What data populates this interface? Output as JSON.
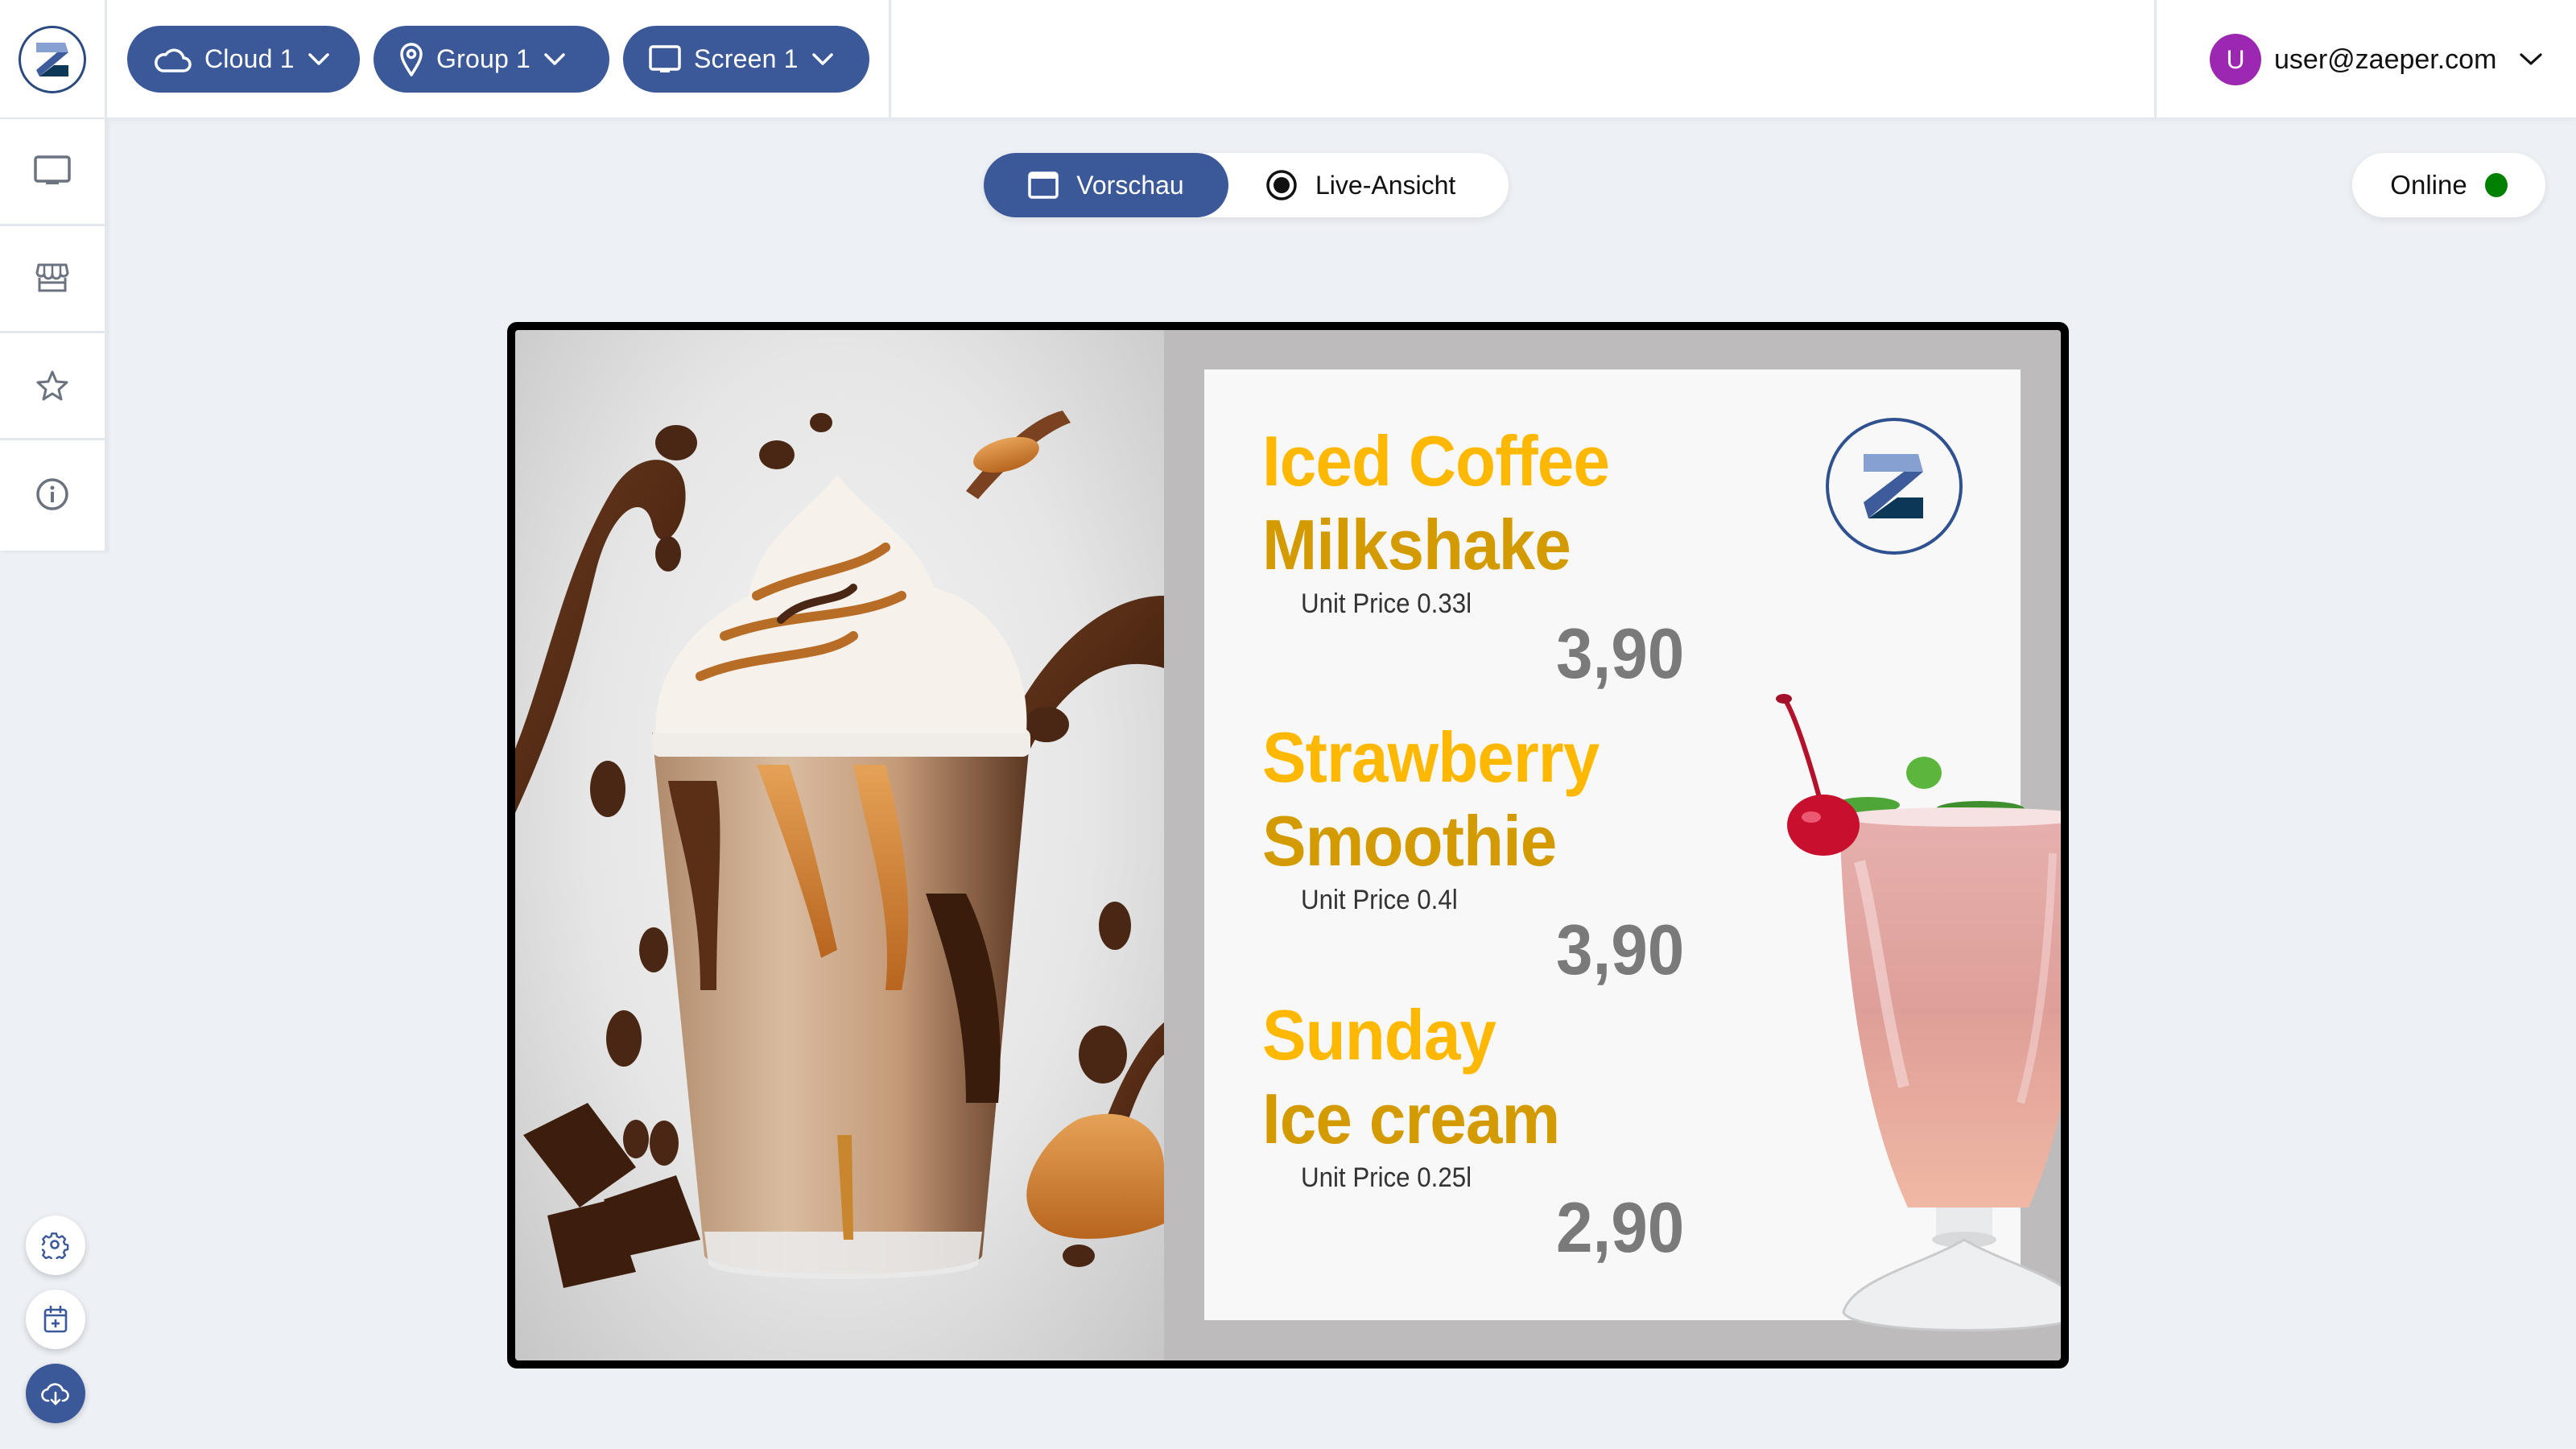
{
  "header": {
    "logo": "zaeper-logo",
    "selectors": [
      {
        "label": "Cloud 1",
        "icon": "cloud-icon"
      },
      {
        "label": "Group 1",
        "icon": "map-pin-icon"
      },
      {
        "label": "Screen 1",
        "icon": "monitor-icon"
      }
    ],
    "user": {
      "initial": "U",
      "email": "user@zaeper.com",
      "avatar_color": "#9c27b0"
    }
  },
  "sidebar": {
    "items": [
      {
        "name": "screens",
        "icon": "monitor-icon"
      },
      {
        "name": "store",
        "icon": "store-icon"
      },
      {
        "name": "favorites",
        "icon": "star-icon"
      },
      {
        "name": "info",
        "icon": "info-icon"
      }
    ],
    "actions": [
      {
        "name": "settings",
        "icon": "gear-icon"
      },
      {
        "name": "schedule",
        "icon": "calendar-plus-icon"
      },
      {
        "name": "cloud-download",
        "icon": "cloud-download-icon"
      }
    ]
  },
  "view_toggle": {
    "options": [
      {
        "label": "Vorschau",
        "icon": "window-icon",
        "active": true
      },
      {
        "label": "Live-Ansicht",
        "icon": "radio-dot-icon",
        "active": false
      }
    ]
  },
  "status": {
    "label": "Online",
    "color": "#008000"
  },
  "preview": {
    "images": [
      "iced-coffee-milkshake-photo",
      "strawberry-smoothie-photo"
    ],
    "menu": [
      {
        "line1": "Iced Coffee",
        "line2": "Milkshake",
        "unit": "Unit Price 0.33l",
        "price": "3,90"
      },
      {
        "line1": "Strawberry",
        "line2": "Smoothie",
        "unit": "Unit Price 0.4l",
        "price": "3,90"
      },
      {
        "line1": "Sunday",
        "line2": "Ice cream",
        "unit": "Unit Price 0.25l",
        "price": "2,90"
      }
    ]
  },
  "colors": {
    "accent": "#3b5998",
    "title_yellow": "#ffb800",
    "title_gold": "#d49b00",
    "price_gray": "#7a7a7a",
    "page_bg": "#edf0f5"
  }
}
